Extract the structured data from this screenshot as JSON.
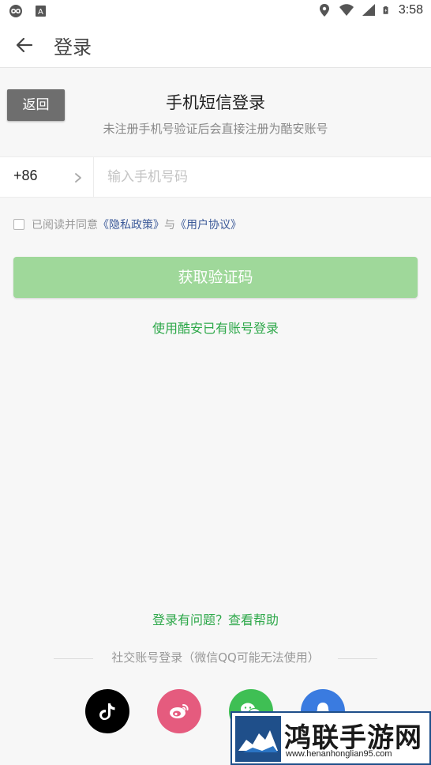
{
  "status_bar": {
    "time": "3:58",
    "left_icons": [
      "infinity-app-icon",
      "accessibility-a-icon"
    ],
    "right_icons": [
      "location-icon",
      "wifi-icon",
      "signal-icon",
      "battery-charging-icon"
    ]
  },
  "toolbar": {
    "title": "登录",
    "back_icon": "arrow-left-icon"
  },
  "header": {
    "return_button": "返回",
    "title": "手机短信登录",
    "subtitle": "未注册手机号验证后会直接注册为酷安账号"
  },
  "phone": {
    "country_code": "+86",
    "placeholder": "输入手机号码",
    "value": ""
  },
  "agreement": {
    "prefix": "已阅读并同意",
    "privacy": "《隐私政策》",
    "and": "与",
    "terms": "《用户协议》",
    "checked": false
  },
  "actions": {
    "get_code": "获取验证码",
    "alt_login": "使用酷安已有账号登录",
    "help": "登录有问题？查看帮助"
  },
  "social": {
    "label": "社交账号登录（微信QQ可能无法使用）",
    "providers": [
      "tiktok-icon",
      "weibo-icon",
      "wechat-icon",
      "qq-icon"
    ]
  },
  "colors": {
    "accent_green": "#2ea84a",
    "button_disabled_green": "#9fd89a",
    "link_blue": "#3c5a99"
  },
  "watermark": {
    "title": "鸿联手游网",
    "url": "www.henanhonglian95.com"
  }
}
